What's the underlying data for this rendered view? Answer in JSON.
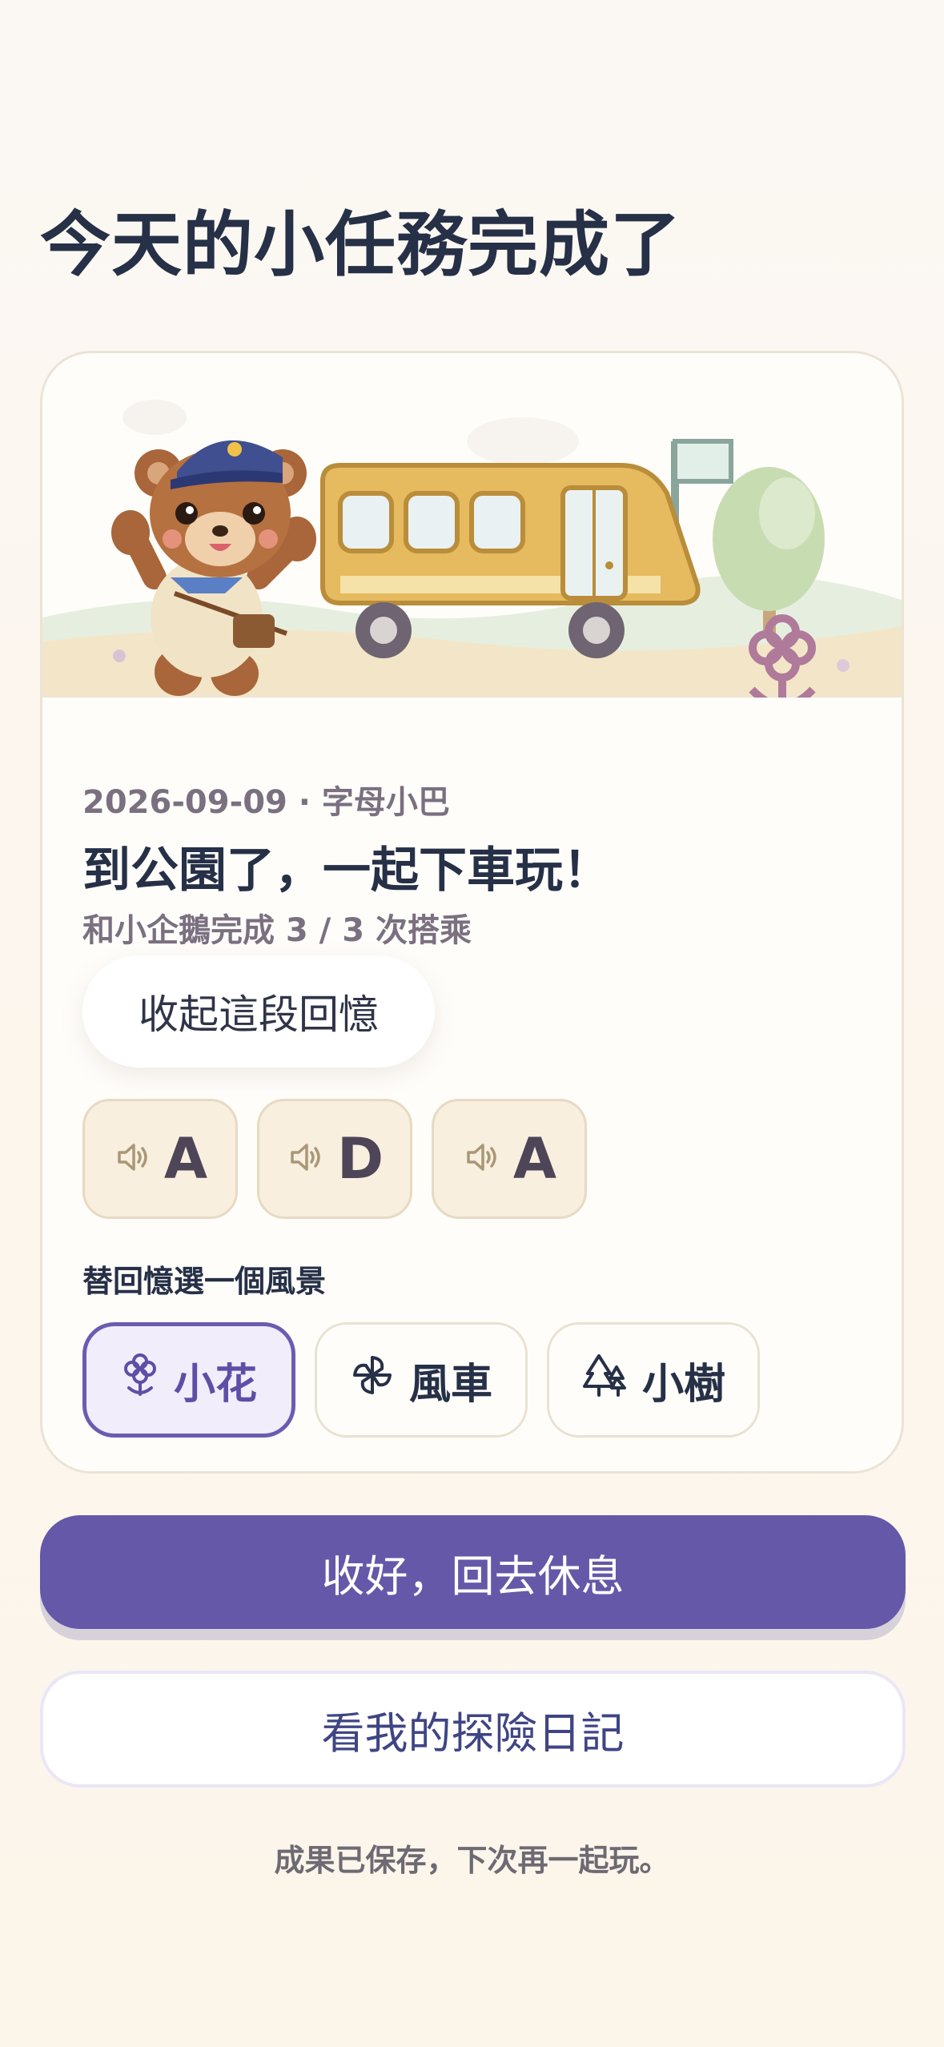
{
  "page": {
    "title": "今天的小任務完成了"
  },
  "memory": {
    "meta": "2026-09-09 · 字母小巴",
    "title": "到公園了，一起下車玩！",
    "rides": "和小企鵝完成 3 / 3 次搭乘",
    "collapse_label": "收起這段回憶",
    "letters": [
      {
        "letter": "A",
        "icon": "speaker-icon"
      },
      {
        "letter": "D",
        "icon": "speaker-icon"
      },
      {
        "letter": "A",
        "icon": "speaker-icon"
      }
    ]
  },
  "scenery": {
    "label": "替回憶選一個風景",
    "options": [
      {
        "label": "小花",
        "icon": "flower-icon",
        "selected": true
      },
      {
        "label": "風車",
        "icon": "pinwheel-icon",
        "selected": false
      },
      {
        "label": "小樹",
        "icon": "tree-icon",
        "selected": false
      }
    ]
  },
  "actions": {
    "primary_label": "收好，回去休息",
    "secondary_label": "看我的探險日記"
  },
  "footer": {
    "note": "成果已保存，下次再一起玩。"
  },
  "colors": {
    "accent": "#6558a8",
    "title": "#263047",
    "bus_yellow": "#e6ba5e",
    "letter_tile": "#f8efdf"
  }
}
